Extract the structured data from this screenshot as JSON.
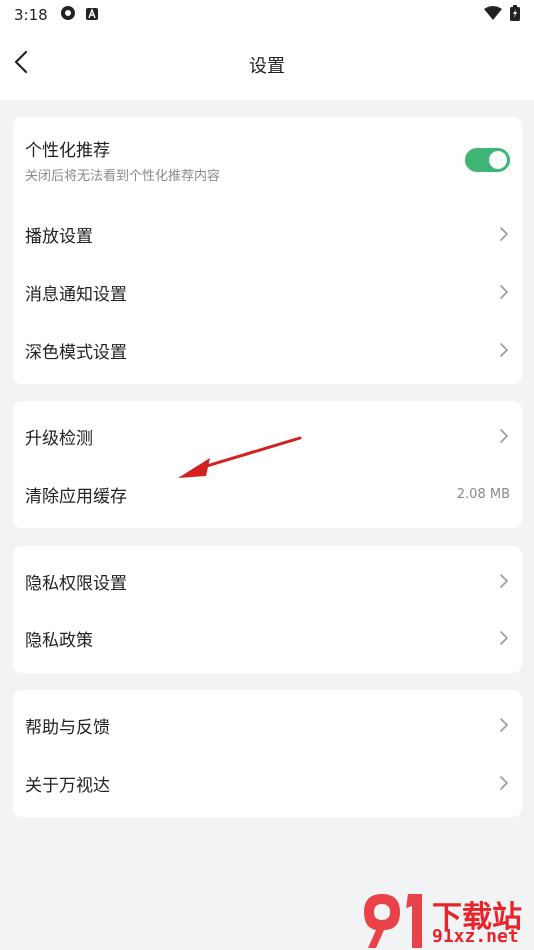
{
  "status_bar": {
    "time": "3:18"
  },
  "header": {
    "title": "设置"
  },
  "groups": [
    {
      "items": [
        {
          "label": "个性化推荐",
          "subtitle": "关闭后将无法看到个性化推荐内容",
          "toggle_on": true
        },
        {
          "label": "播放设置"
        },
        {
          "label": "消息通知设置"
        },
        {
          "label": "深色模式设置"
        }
      ]
    },
    {
      "items": [
        {
          "label": "升级检测"
        },
        {
          "label": "清除应用缓存",
          "value": "2.08 MB"
        }
      ]
    },
    {
      "items": [
        {
          "label": "隐私权限设置"
        },
        {
          "label": "隐私政策"
        }
      ]
    },
    {
      "items": [
        {
          "label": "帮助与反馈"
        },
        {
          "label": "关于万视达"
        }
      ]
    }
  ],
  "watermark": {
    "line1": "下载站",
    "line2": "91xz.net"
  },
  "colors": {
    "toggle_on": "#3fb574",
    "background": "#f2f3f5",
    "annotation_arrow": "#d42020"
  }
}
